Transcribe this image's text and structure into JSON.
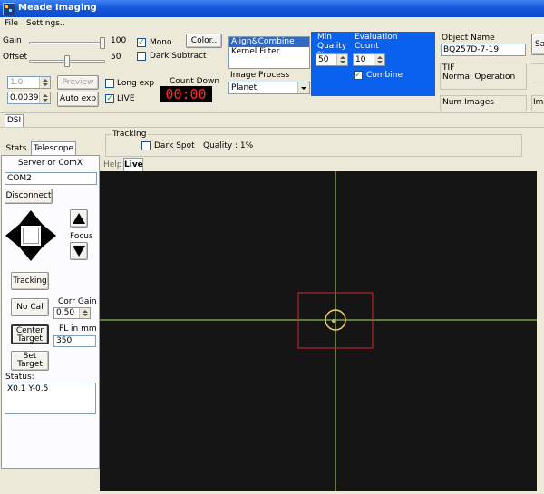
{
  "window": {
    "title": "Meade Imaging"
  },
  "menu": [
    "File",
    "Settings.."
  ],
  "toolbar": {
    "gain_label": "Gain",
    "gain_value": "100",
    "gain_level": 1.0,
    "offset_label": "Offset",
    "offset_value": "50",
    "offset_level": 0.5,
    "spin1_value": "1.0",
    "exposure_value": "0.0039",
    "preview_label": "Preview",
    "auto_exp_label": "Auto exp",
    "mono_label": "Mono",
    "mono_checked": true,
    "dark_subtract_label": "Dark Subtract",
    "dark_subtract_checked": false,
    "color_label": "Color..",
    "long_exp_label": "Long exp",
    "long_exp_checked": false,
    "live_label": "LIVE",
    "live_checked": true,
    "countdown_label": "Count Down",
    "countdown_value": "00:00"
  },
  "process": {
    "list": [
      "Align&Combine",
      "Kernel Filter"
    ],
    "selected": "Align&Combine",
    "image_process_label": "Image Process",
    "image_process_value": "Planet"
  },
  "quality_panel": {
    "min_quality_label": "Min Quality %",
    "min_quality_value": "50",
    "eval_count_label": "Evaluation Count",
    "eval_count_value": "10",
    "combine_label": "Combine",
    "combine_checked": true
  },
  "object": {
    "name_label": "Object Name",
    "name_value": "BQ257D-7-19",
    "format": "TIF",
    "operation": "Normal Operation",
    "num_images_label": "Num Images",
    "right_button_label": "Sa",
    "right_button2_label": "Ima"
  },
  "tabs_top": [
    "DSI"
  ],
  "tracking": {
    "title": "Tracking",
    "dark_spot_label": "Dark Spot",
    "dark_spot_checked": false,
    "quality_text": "Quality : 1%"
  },
  "side_tabs": [
    "Stats",
    "Telescope"
  ],
  "telescope": {
    "server_label": "Server or ComX",
    "server_value": "COM2",
    "disconnect_label": "Disconnect",
    "focus_label": "Focus",
    "tracking_label": "Tracking",
    "no_cal_label": "No Cal",
    "corr_gain_label": "Corr Gain",
    "corr_gain_value": "0.50",
    "center_target_label": "Center Target",
    "fl_label": "FL in mm",
    "fl_value": "350",
    "set_target_label": "Set Target",
    "status_label": "Status:",
    "status_value": "X0.1 Y-0.5"
  },
  "view_tabs": [
    "Help",
    "Live"
  ],
  "view_tab_active": "Live",
  "colors": {
    "title_blue": "#0a4bcf",
    "panel_blue": "#0a61ee",
    "countdown_red": "#ff2a2a",
    "crosshair": "#a6e36b",
    "target_box": "#d1262e",
    "target_circle": "#f0d45a"
  }
}
